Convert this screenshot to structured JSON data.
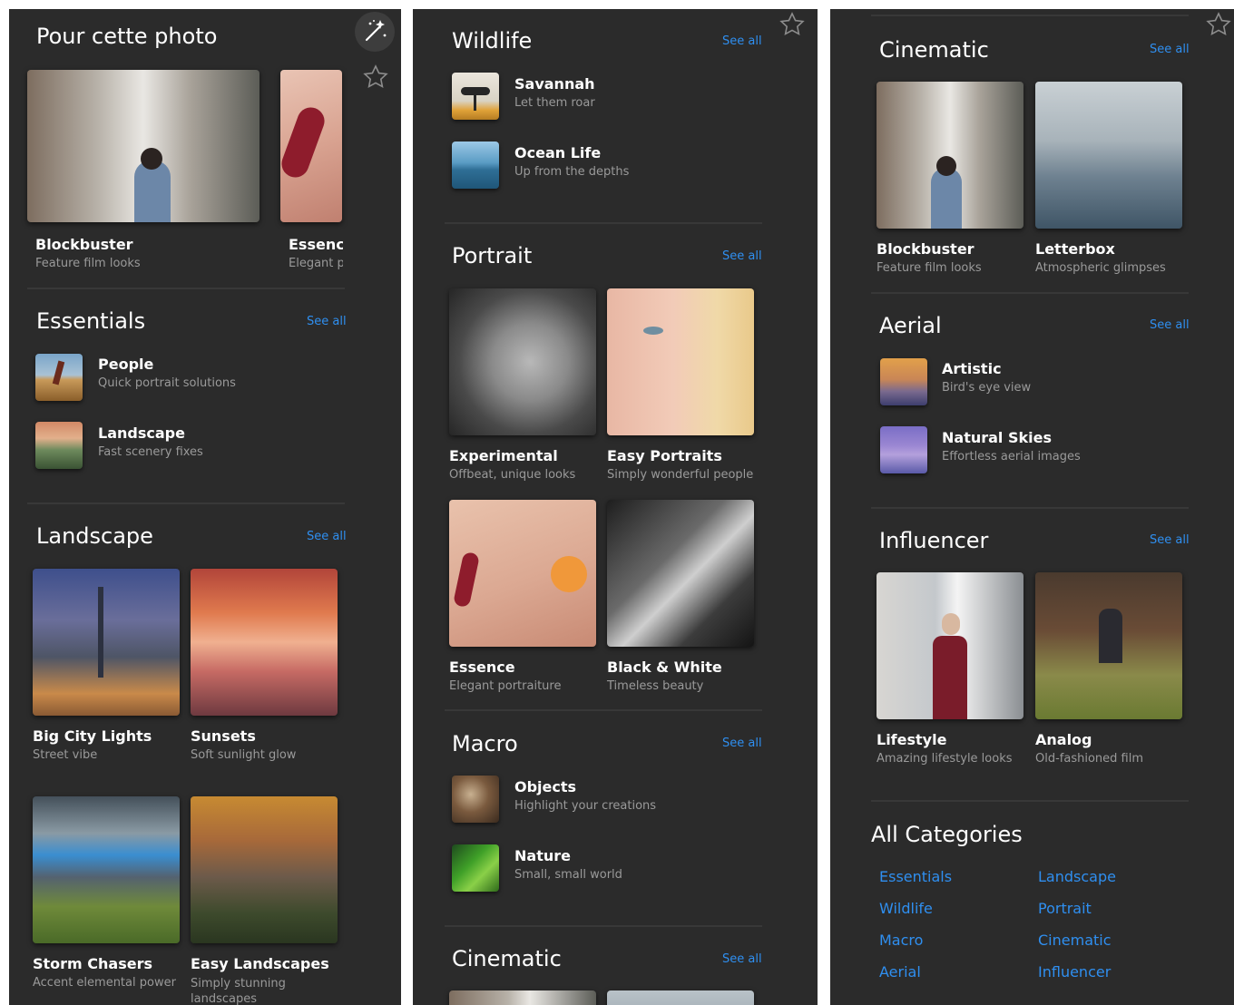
{
  "panel1": {
    "header": "Pour cette photo",
    "top_cards": [
      {
        "title": "Blockbuster",
        "subtitle": "Feature film looks"
      },
      {
        "title": "Essence",
        "subtitle": "Elegant portraiture"
      }
    ],
    "essentials": {
      "title": "Essentials",
      "see_all": "See all",
      "items": [
        {
          "title": "People",
          "subtitle": "Quick portrait solutions"
        },
        {
          "title": "Landscape",
          "subtitle": "Fast scenery fixes"
        }
      ]
    },
    "landscape": {
      "title": "Landscape",
      "see_all": "See all",
      "cards": [
        {
          "title": "Big City Lights",
          "subtitle": "Street vibe"
        },
        {
          "title": "Sunsets",
          "subtitle": "Soft sunlight glow"
        },
        {
          "title": "Storm Chasers",
          "subtitle": "Accent elemental power"
        },
        {
          "title": "Easy Landscapes",
          "subtitle": "Simply stunning landscapes"
        }
      ]
    }
  },
  "panel2": {
    "wildlife": {
      "title": "Wildlife",
      "see_all": "See all",
      "items": [
        {
          "title": "Savannah",
          "subtitle": "Let them roar"
        },
        {
          "title": "Ocean Life",
          "subtitle": "Up from the depths"
        }
      ]
    },
    "portrait": {
      "title": "Portrait",
      "see_all": "See all",
      "cards": [
        {
          "title": "Experimental",
          "subtitle": "Offbeat, unique looks"
        },
        {
          "title": "Easy Portraits",
          "subtitle": "Simply wonderful people"
        },
        {
          "title": "Essence",
          "subtitle": "Elegant portraiture"
        },
        {
          "title": "Black & White",
          "subtitle": "Timeless beauty"
        }
      ]
    },
    "macro": {
      "title": "Macro",
      "see_all": "See all",
      "items": [
        {
          "title": "Objects",
          "subtitle": "Highlight your creations"
        },
        {
          "title": "Nature",
          "subtitle": "Small, small world"
        }
      ]
    },
    "cinematic": {
      "title": "Cinematic",
      "see_all": "See all"
    }
  },
  "panel3": {
    "cinematic": {
      "title": "Cinematic",
      "see_all": "See all",
      "cards": [
        {
          "title": "Blockbuster",
          "subtitle": "Feature film looks"
        },
        {
          "title": "Letterbox",
          "subtitle": "Atmospheric glimpses"
        }
      ]
    },
    "aerial": {
      "title": "Aerial",
      "see_all": "See all",
      "items": [
        {
          "title": "Artistic",
          "subtitle": "Bird's eye view"
        },
        {
          "title": "Natural Skies",
          "subtitle": "Effortless aerial images"
        }
      ]
    },
    "influencer": {
      "title": "Influencer",
      "see_all": "See all",
      "cards": [
        {
          "title": "Lifestyle",
          "subtitle": "Amazing lifestyle looks"
        },
        {
          "title": "Analog",
          "subtitle": "Old-fashioned film"
        }
      ]
    },
    "all_categories": {
      "title": "All Categories",
      "links": [
        "Essentials",
        "Landscape",
        "Wildlife",
        "Portrait",
        "Macro",
        "Cinematic",
        "Aerial",
        "Influencer"
      ]
    }
  },
  "colors": {
    "panel_bg": "#2b2b2b",
    "accent_link": "#2f8ff0",
    "subtitle": "#9a9a9a"
  },
  "icons": [
    "magic-wand-icon",
    "star-outline-icon"
  ]
}
